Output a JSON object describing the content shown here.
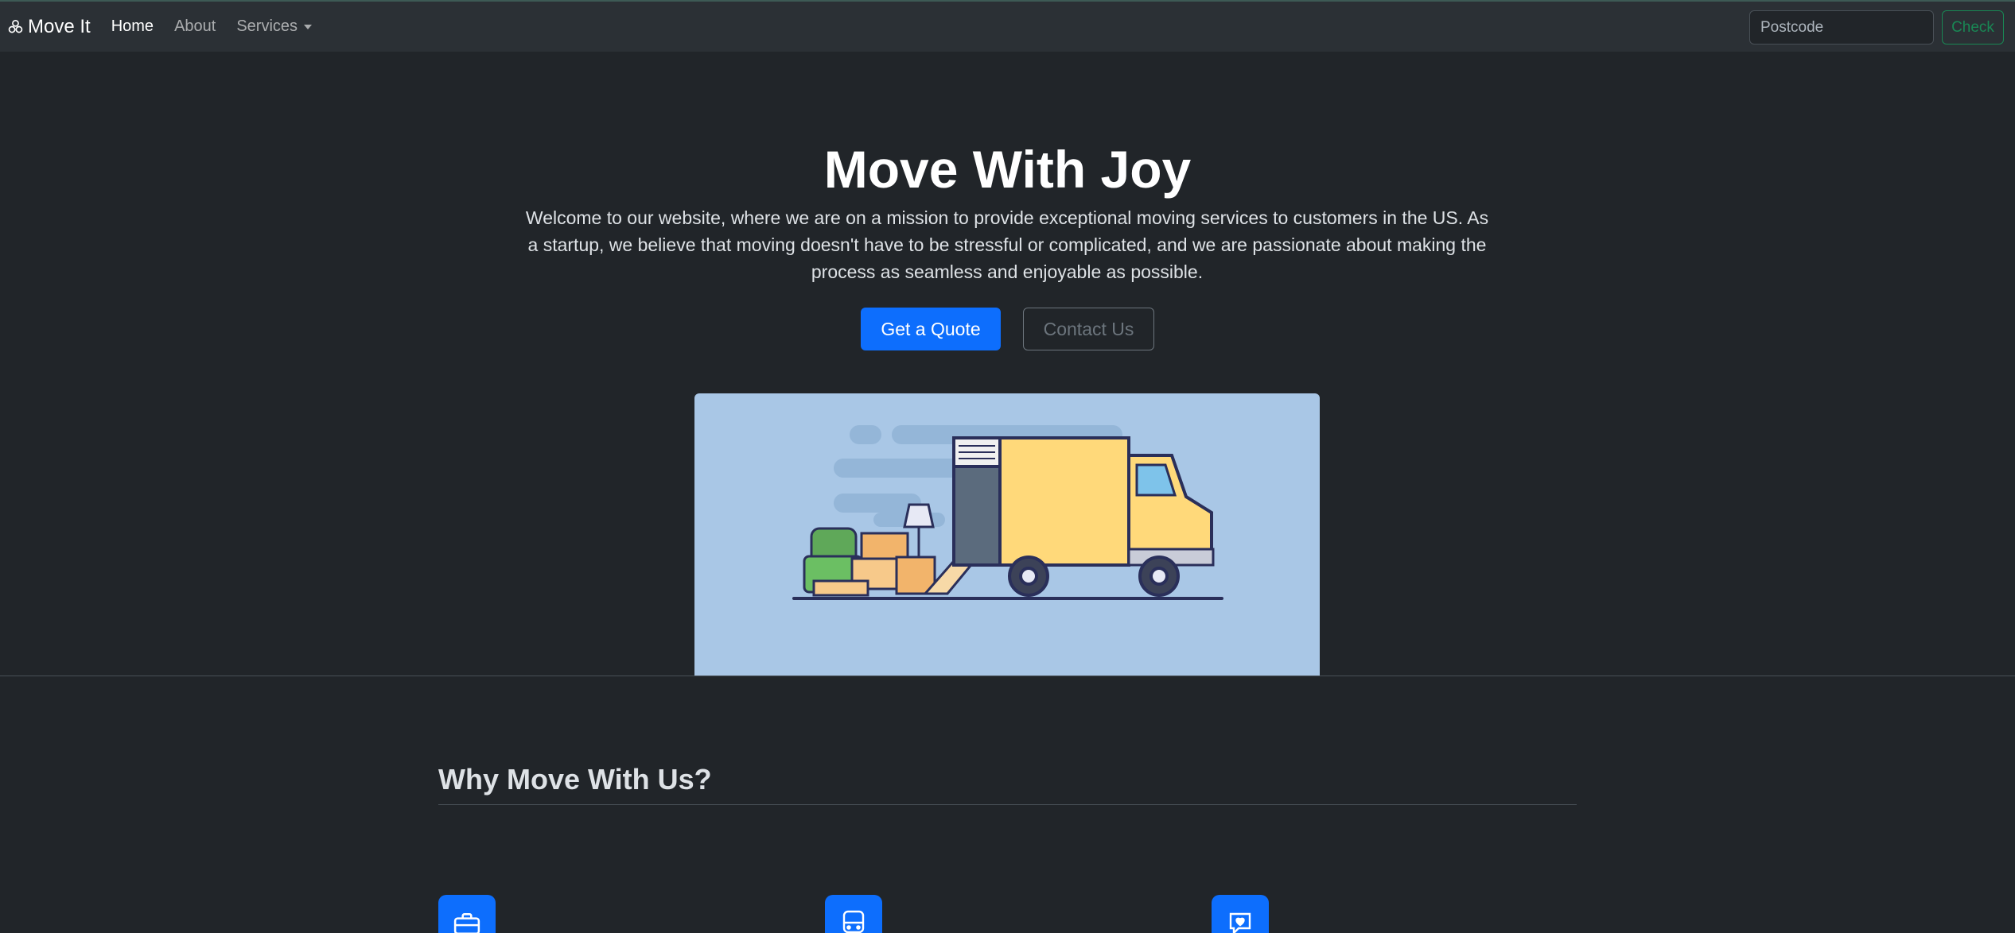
{
  "navbar": {
    "brand": "Move It",
    "links": [
      {
        "label": "Home",
        "active": true
      },
      {
        "label": "About",
        "active": false
      },
      {
        "label": "Services",
        "active": false,
        "dropdown": true
      }
    ],
    "search": {
      "placeholder": "Postcode",
      "button_label": "Check"
    }
  },
  "hero": {
    "title": "Move With Joy",
    "lead": "Welcome to our website, where we are on a mission to provide exceptional moving services to customers in the US. As a startup, we believe that moving doesn't have to be stressful or complicated, and we are passionate about making the process as seamless and enjoyable as possible.",
    "primary_button": "Get a Quote",
    "secondary_button": "Contact Us",
    "image_icon": "moving-truck-illustration"
  },
  "features": {
    "title": "Why Move With Us?",
    "items": [
      {
        "icon": "briefcase-icon"
      },
      {
        "icon": "bus-icon"
      },
      {
        "icon": "chat-heart-icon"
      }
    ]
  },
  "colors": {
    "background": "#212529",
    "navbar": "#2b3035",
    "primary": "#0d6efd",
    "success": "#198754",
    "hero_image_bg": "#a9c7e6"
  }
}
